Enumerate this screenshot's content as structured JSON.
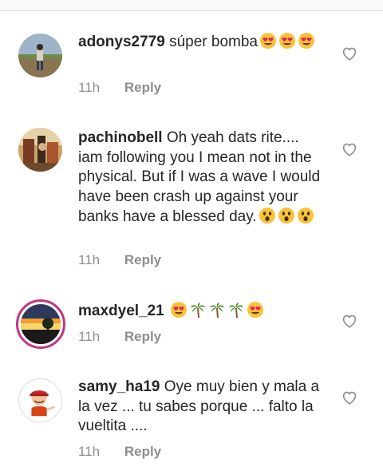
{
  "comments": [
    {
      "username": "adonys2779",
      "text": "súper bomba",
      "emojis": [
        "heart-eyes",
        "heart-eyes",
        "heart-eyes"
      ],
      "time": "11h",
      "reply_label": "Reply"
    },
    {
      "username": "pachinobell",
      "text": "Oh yeah dats rite.... iam following you I mean not in the physical. But if I was a wave I would have been crash up against your banks have a blessed day.",
      "emojis": [
        "astonished",
        "astonished",
        "astonished"
      ],
      "time": "11h",
      "reply_label": "Reply"
    },
    {
      "username": "maxdyel_21",
      "text": "",
      "emojis": [
        "heart-eyes",
        "palm-tree",
        "palm-tree",
        "palm-tree",
        "heart-eyes"
      ],
      "time": "11h",
      "reply_label": "Reply"
    },
    {
      "username": "samy_ha19",
      "text": "Oye muy bien y mala a la vez ... tu sabes porque ... falto la vueltita ....",
      "emojis": [],
      "time": "11h",
      "reply_label": "Reply"
    }
  ],
  "colors": {
    "text": "#262626",
    "meta": "#8e8e8e",
    "story_ring": "#c13584"
  }
}
